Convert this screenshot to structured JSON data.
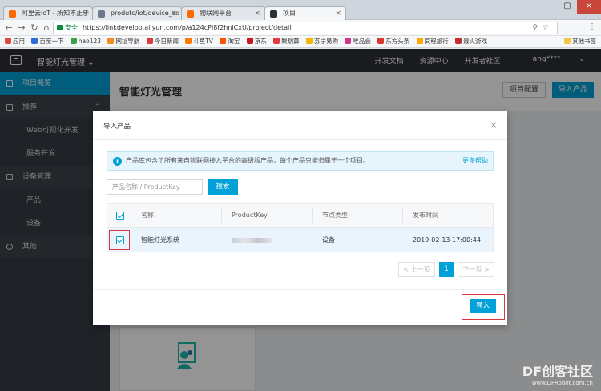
{
  "browser": {
    "tabs": [
      {
        "label": "阿里云IoT - 所知不止于"
      },
      {
        "label": "produtc/iot/device_co"
      },
      {
        "label": "物联网平台"
      },
      {
        "label": "项目"
      }
    ],
    "url_secure": "安全",
    "url": "https://linkdevelop.aliyun.com/p/a124cPI8f2hnlCxU/project/detail",
    "bookmarks": [
      "应用",
      "百度一下",
      "hao123",
      "网址导航",
      "今日新闻",
      "斗鱼TV",
      "淘宝",
      "京东",
      "聚划算",
      "苏宁易购",
      "唯品会",
      "东方头条",
      "同程旅行",
      "最火游戏"
    ],
    "bookmarks_right": "其他书签"
  },
  "app": {
    "project_name": "智能灯光管理",
    "nav": [
      "开发文档",
      "资源中心",
      "开发者社区",
      "ang****"
    ]
  },
  "sidebar": {
    "items": [
      {
        "label": "项目概览"
      },
      {
        "label": "推荐"
      },
      {
        "label": "Web可视化开发"
      },
      {
        "label": "服务开发"
      },
      {
        "label": "设备管理"
      },
      {
        "label": "产品"
      },
      {
        "label": "设备"
      },
      {
        "label": "其他"
      }
    ]
  },
  "main": {
    "title": "智能灯光管理",
    "config_button": "项目配置",
    "import_product_button": "导入产品"
  },
  "modal": {
    "title": "导入产品",
    "notice": "产品库包含了所有来自物联网接入平台的高级版产品，每个产品只能归属于一个项目。",
    "more_help": "更多帮助",
    "search_placeholder": "产品名称 / ProductKey",
    "search_button": "搜索",
    "columns": [
      "名称",
      "ProductKey",
      "节点类型",
      "发布时间"
    ],
    "rows": [
      {
        "name": "智能灯光系统",
        "node_type": "设备",
        "time": "2019-02-13 17:00:44"
      }
    ],
    "pager": {
      "prev": "< 上一页",
      "current": "1",
      "next": "下一页 >"
    },
    "import_button": "导入"
  },
  "watermark": {
    "title": "DF创客社区",
    "sub": "www.DFRobot.com.cn"
  },
  "colors": {
    "accent": "#00a1d6",
    "highlight": "#d9363e",
    "sidebar": "#363d45"
  }
}
